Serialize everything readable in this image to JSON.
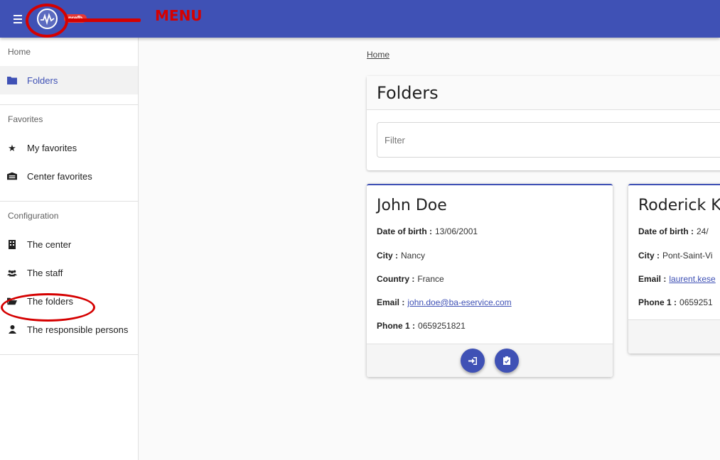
{
  "app": {
    "badge": "prefb",
    "annotation_menu": "MENU",
    "colors": {
      "primary": "#3f51b5",
      "annotation": "#d50000",
      "badge": "#e53935"
    }
  },
  "sidebar": {
    "sections": [
      {
        "label": "Home",
        "items": [
          {
            "label": "Folders",
            "icon": "folder-icon",
            "active": true
          }
        ]
      },
      {
        "label": "Favorites",
        "items": [
          {
            "label": "My favorites",
            "icon": "star-icon"
          },
          {
            "label": "Center favorites",
            "icon": "building-icon"
          }
        ]
      },
      {
        "label": "Configuration",
        "items": [
          {
            "label": "The center",
            "icon": "office-building-icon"
          },
          {
            "label": "The staff",
            "icon": "users-icon"
          },
          {
            "label": "The folders",
            "icon": "folder-open-icon"
          },
          {
            "label": "The responsible persons",
            "icon": "person-icon"
          }
        ]
      }
    ]
  },
  "main": {
    "breadcrumb": "Home",
    "title": "Folders",
    "filter_placeholder": "Filter",
    "labels": {
      "dob": "Date of birth :",
      "city": "City :",
      "country": "Country :",
      "email": "Email :",
      "phone": "Phone 1 :"
    },
    "cards": [
      {
        "name": "John Doe",
        "dob": "13/06/2001",
        "city": "Nancy",
        "country": "France",
        "email": "john.doe@ba-eservice.com",
        "phone": "0659251821",
        "actions": [
          "login-icon",
          "clipboard-check-icon"
        ]
      },
      {
        "name": "Roderick Ke",
        "dob": "24/",
        "city": "Pont-Saint-Vi",
        "email": "laurent.kese",
        "phone": "0659251"
      }
    ]
  }
}
